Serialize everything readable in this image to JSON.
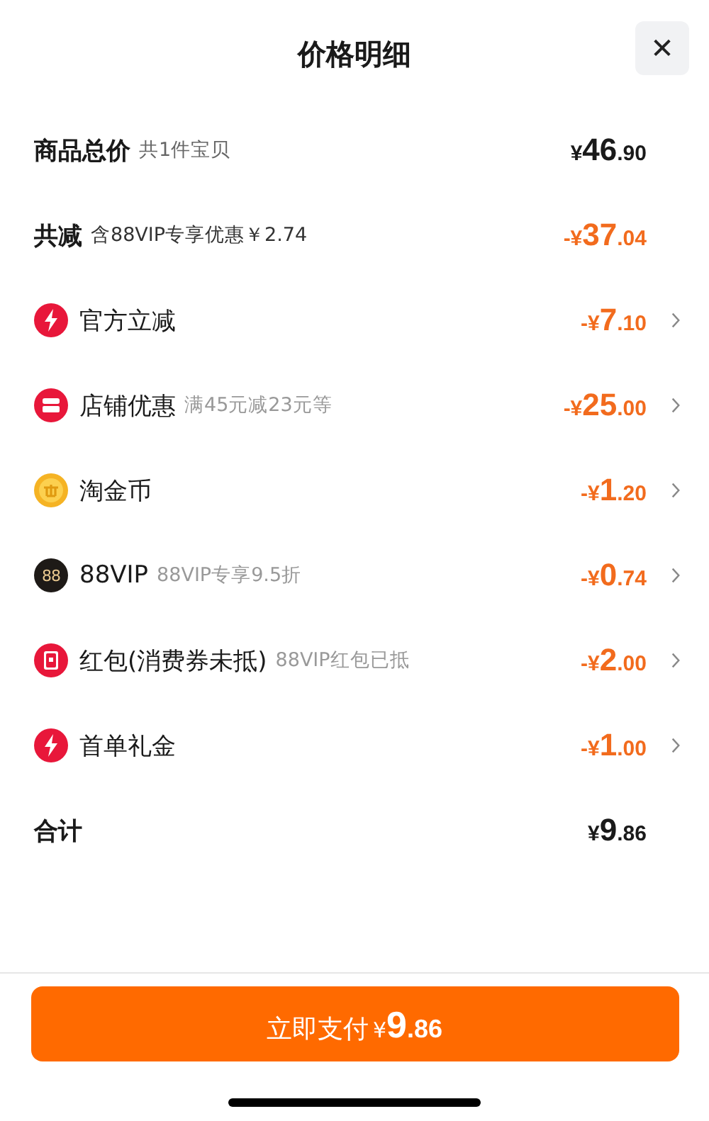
{
  "header": {
    "title": "价格明细",
    "close": "✕"
  },
  "rows": [
    {
      "kind": "summary",
      "label": "商品总价",
      "note": "共1件宝贝",
      "discount": false,
      "amount": {
        "currency": "¥",
        "whole": "46",
        "fraction": ".90"
      }
    },
    {
      "kind": "summary",
      "label": "共减",
      "note": "含88VIP专享优惠￥2.74",
      "discount": true,
      "amount": {
        "currency": "-¥",
        "whole": "37",
        "fraction": ".04"
      }
    },
    {
      "kind": "bolt",
      "label": "官方立减",
      "discount": true,
      "amount": {
        "currency": "-¥",
        "whole": "7",
        "fraction": ".10"
      }
    },
    {
      "kind": "store",
      "label": "店铺优惠",
      "note": "满45元减23元等",
      "discount": true,
      "amount": {
        "currency": "-¥",
        "whole": "25",
        "fraction": ".00"
      }
    },
    {
      "kind": "coin",
      "label": "淘金币",
      "discount": true,
      "amount": {
        "currency": "-¥",
        "whole": "1",
        "fraction": ".20"
      }
    },
    {
      "kind": "vip",
      "badge": "88",
      "label": "88VIP",
      "note": "88VIP专享9.5折",
      "discount": true,
      "amount": {
        "currency": "-¥",
        "whole": "0",
        "fraction": ".74"
      }
    },
    {
      "kind": "packet",
      "label": "红包(消费券未抵)",
      "note": "88VIP红包已抵",
      "discount": true,
      "amount": {
        "currency": "-¥",
        "whole": "2",
        "fraction": ".00"
      }
    },
    {
      "kind": "bolt",
      "label": "首单礼金",
      "discount": true,
      "amount": {
        "currency": "-¥",
        "whole": "1",
        "fraction": ".00"
      }
    },
    {
      "kind": "summary",
      "label": "合计",
      "discount": false,
      "amount": {
        "currency": "¥",
        "whole": "9",
        "fraction": ".86"
      }
    }
  ],
  "pay_button": {
    "label": "立即支付",
    "amount": {
      "currency": "¥",
      "whole": "9",
      "fraction": ".86"
    }
  }
}
